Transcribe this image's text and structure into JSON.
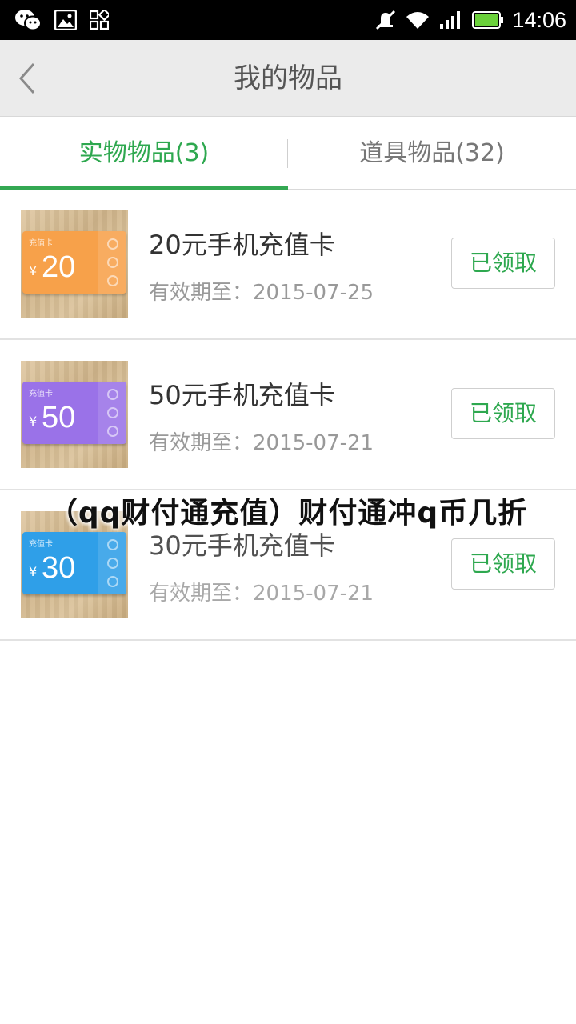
{
  "status_bar": {
    "left_icons": [
      "wechat-icon",
      "image-icon",
      "apps-grid-icon"
    ],
    "right_icons": [
      "mute-icon",
      "wifi-icon",
      "signal-icon",
      "battery-icon"
    ],
    "time": "14:06"
  },
  "header": {
    "title": "我的物品"
  },
  "tabs": [
    {
      "label": "实物物品(3)",
      "active": true
    },
    {
      "label": "道具物品(32)",
      "active": false
    }
  ],
  "items": [
    {
      "card_label": "充值卡",
      "card_yen": "¥",
      "card_amount": "20",
      "card_color": "#f7a14a",
      "name": "20元手机充值卡",
      "expiry": "有效期至：2015-07-25",
      "button": "已领取"
    },
    {
      "card_label": "充值卡",
      "card_yen": "¥",
      "card_amount": "50",
      "card_color": "#9a72e8",
      "name": "50元手机充值卡",
      "expiry": "有效期至：2015-07-21",
      "button": "已领取"
    },
    {
      "card_label": "充值卡",
      "card_yen": "¥",
      "card_amount": "30",
      "card_color": "#2f9fe8",
      "name": "30元手机充值卡",
      "expiry": "有效期至：2015-07-21",
      "button": "已领取"
    }
  ],
  "overlay": {
    "caption": "（qq财付通充值）财付通冲q币几折"
  },
  "colors": {
    "accent_green": "#2ea84f",
    "title_bar": "#ebebeb"
  }
}
